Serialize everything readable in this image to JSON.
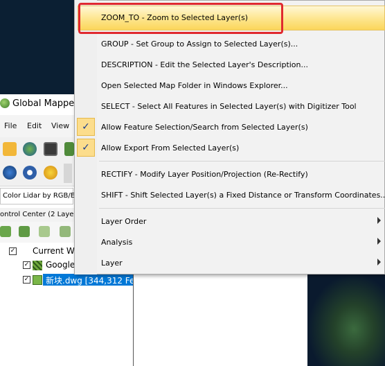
{
  "window": {
    "title": "Global Mapper"
  },
  "menubar": {
    "file": "File",
    "edit": "Edit",
    "view": "View"
  },
  "layer_dropdown": {
    "value": "Color Lidar by RGB/E"
  },
  "control_center": {
    "title": "ontrol Center (2 Laye",
    "tree": {
      "root_label": "Current W",
      "item1_label": "Google",
      "item2_label": "新块.dwg [344,312 Fe"
    }
  },
  "context_menu": {
    "items": [
      {
        "label": "ZOOM_TO - Zoom to Selected Layer(s)"
      },
      {
        "label": "GROUP - Set Group to Assign to Selected Layer(s)..."
      },
      {
        "label": "DESCRIPTION - Edit the Selected Layer's Description..."
      },
      {
        "label": "Open Selected Map Folder in Windows Explorer..."
      },
      {
        "label": "SELECT - Select All Features in Selected Layer(s) with Digitizer Tool"
      },
      {
        "label": "Allow Feature Selection/Search from Selected Layer(s)",
        "checked": true
      },
      {
        "label": "Allow Export From Selected Layer(s)",
        "checked": true
      },
      {
        "label": "RECTIFY - Modify Layer Position/Projection (Re-Rectify)"
      },
      {
        "label": "SHIFT - Shift Selected Layer(s) a Fixed Distance or Transform Coordinates..."
      },
      {
        "label": "Layer Order",
        "submenu": true
      },
      {
        "label": "Analysis",
        "submenu": true
      },
      {
        "label": "Layer",
        "submenu": true
      }
    ],
    "check_glyph": "✓"
  },
  "colors": {
    "highlight": "#fde58c",
    "annotation_box": "#e0292f",
    "selection": "#0078d7"
  }
}
